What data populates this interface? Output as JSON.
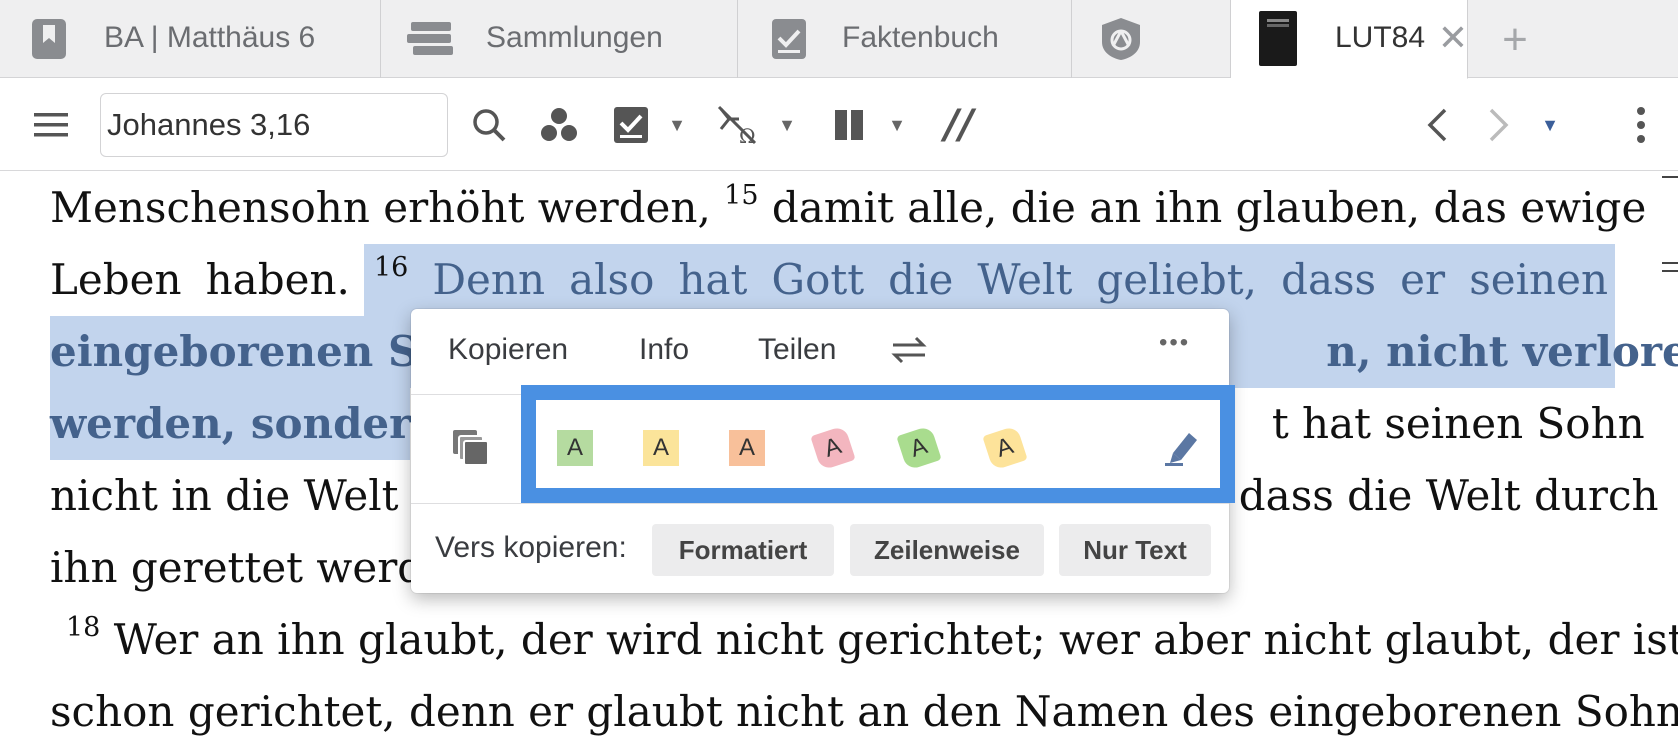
{
  "tabs": [
    {
      "label": "BA | Matthäus 6",
      "icon": "bookmark-icon"
    },
    {
      "label": "Sammlungen",
      "icon": "stack-icon"
    },
    {
      "label": "Faktenbuch",
      "icon": "checkbook-icon"
    },
    {
      "label": "",
      "icon": "shield-logo-icon"
    },
    {
      "label": "LUT84",
      "icon": "bible-cover-icon",
      "close": "✕"
    }
  ],
  "tab_add": "+",
  "toolbar": {
    "reference_value": "Johannes 3,16",
    "parallel_label": "//"
  },
  "text": {
    "line1_a": "Menschensohn erhöht werden, ",
    "v15": "15",
    "line1_b": " damit alle, die an ihn glauben, das ewige",
    "line2_a": "Leben haben. ",
    "v16": "16",
    "line2_b": " Denn also hat Gott die Welt geliebt, dass er seinen",
    "line3_a": "eingeborenen So",
    "line3_b": "n, nicht verloren",
    "line4_a": "werden, sondern",
    "line4_b": "t hat seinen Sohn",
    "line5_a": "nicht in die Welt g",
    "line5_b": "dass die Welt durch",
    "line6_a": "ihn gerettet werde",
    "v18": "18",
    "line7": " Wer an ihn glaubt, der wird nicht gerichtet; wer aber nicht glaubt, der ist",
    "line8": "schon gerichtet, denn er glaubt nicht an den Namen des eingeborenen Sohnes"
  },
  "popup": {
    "copy": "Kopieren",
    "info": "Info",
    "share": "Teilen",
    "more": "•••",
    "swatch_letter": "A",
    "highlight_colors": [
      "#b5dba0",
      "#fbe49a",
      "#f8c09a",
      "#f3b6bf",
      "#a9dc8e",
      "#fde39a"
    ],
    "copy_verse_label": "Vers kopieren:",
    "copy_options": [
      "Formatiert",
      "Zeilenweise",
      "Nur Text"
    ]
  },
  "colors": {
    "selection": "#c2d4ed",
    "selection_text": "#44628c",
    "focus_frame": "#4a90e2"
  }
}
